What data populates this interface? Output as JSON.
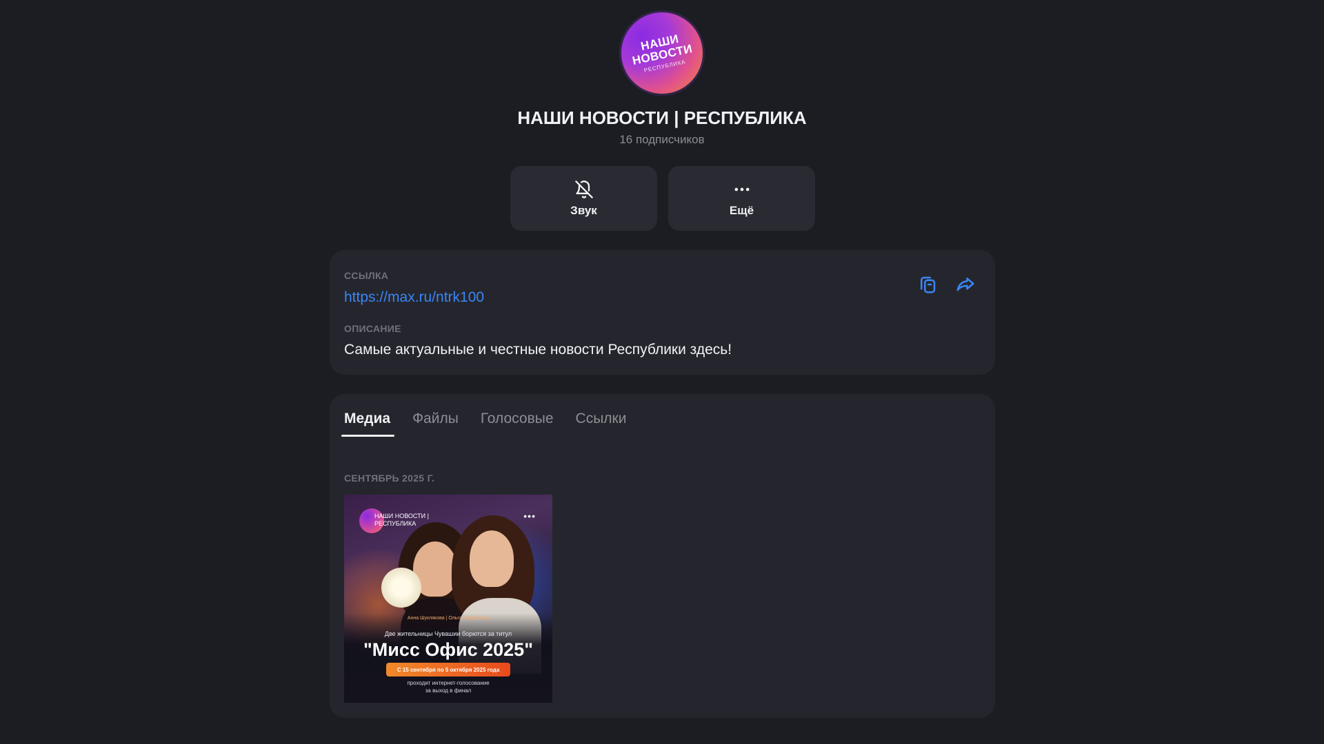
{
  "channel": {
    "avatar_text_1": "НАШИ",
    "avatar_text_2": "НОВОСТИ",
    "avatar_text_3": "РЕСПУБЛИКА",
    "title": "НАШИ НОВОСТИ | РЕСПУБЛИКА",
    "subscribers": "16 подписчиков"
  },
  "actions": {
    "sound_label": "Звук",
    "more_label": "Ещё"
  },
  "info": {
    "link_label": "ССЫЛКА",
    "link_value": "https://max.ru/ntrk100",
    "description_label": "ОПИСАНИЕ",
    "description_value": "Самые актуальные и честные новости Республики здесь!"
  },
  "media": {
    "tabs": [
      {
        "label": "Медиа",
        "active": true
      },
      {
        "label": "Файлы",
        "active": false
      },
      {
        "label": "Голосовые",
        "active": false
      },
      {
        "label": "Ссылки",
        "active": false
      }
    ],
    "month_label": "СЕНТЯБРЬ 2025 Г.",
    "thumbnail": {
      "brand_text": "НАШИ НОВОСТИ | РЕСПУБЛИКА",
      "names_text": "Анна Шуклякова | Ольга Грядовкина",
      "pre_title": "Две жительницы Чувашии борются за титул",
      "main_title": "\"Мисс Офис 2025\"",
      "date_text": "С 15 сентября по 5 октября 2025 года",
      "footer_text_1": "проходит интернет-голосование",
      "footer_text_2": "за выход в финал"
    }
  },
  "colors": {
    "background": "#1c1d22",
    "card": "#25262d",
    "button": "#2a2b32",
    "accent_link": "#3a86f7",
    "muted_text": "#8c8e96"
  },
  "icons": {
    "sound": "bell-off-icon",
    "more": "more-dots-icon",
    "copy": "copy-icon",
    "share": "share-icon"
  }
}
